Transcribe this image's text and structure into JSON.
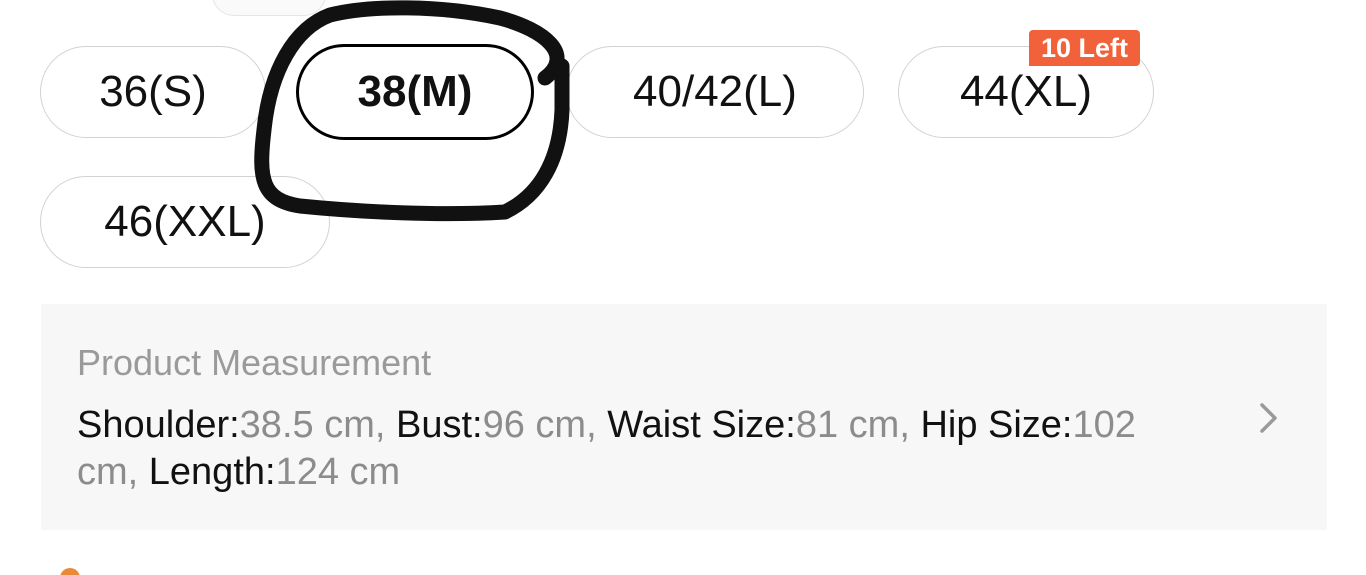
{
  "sizes": {
    "options": [
      {
        "label": "36(S)",
        "selected": false
      },
      {
        "label": "38(M)",
        "selected": true
      },
      {
        "label": "40/42(L)",
        "selected": false
      },
      {
        "label": "44(XL)",
        "selected": false,
        "badge": "10 Left"
      },
      {
        "label": "46(XXL)",
        "selected": false
      }
    ]
  },
  "measurement": {
    "title": "Product Measurement",
    "fields": [
      {
        "label": "Shoulder:",
        "value": "38.5 cm",
        "sep": ", "
      },
      {
        "label": "Bust:",
        "value": "96 cm",
        "sep": ", "
      },
      {
        "label": "Waist Size:",
        "value": "81 cm",
        "sep": ", "
      },
      {
        "label": "Hip Size:",
        "value": "102 cm",
        "sep": ", "
      },
      {
        "label": "Length:",
        "value": "124 cm",
        "sep": ""
      }
    ]
  },
  "colors": {
    "badge_bg": "#f2623a",
    "selected_border": "#000000",
    "chip_border": "#d2d2d2",
    "card_bg": "#f7f7f7",
    "annotation_ink": "#111111"
  },
  "icons": {
    "chevron": "chevron-right-icon"
  }
}
